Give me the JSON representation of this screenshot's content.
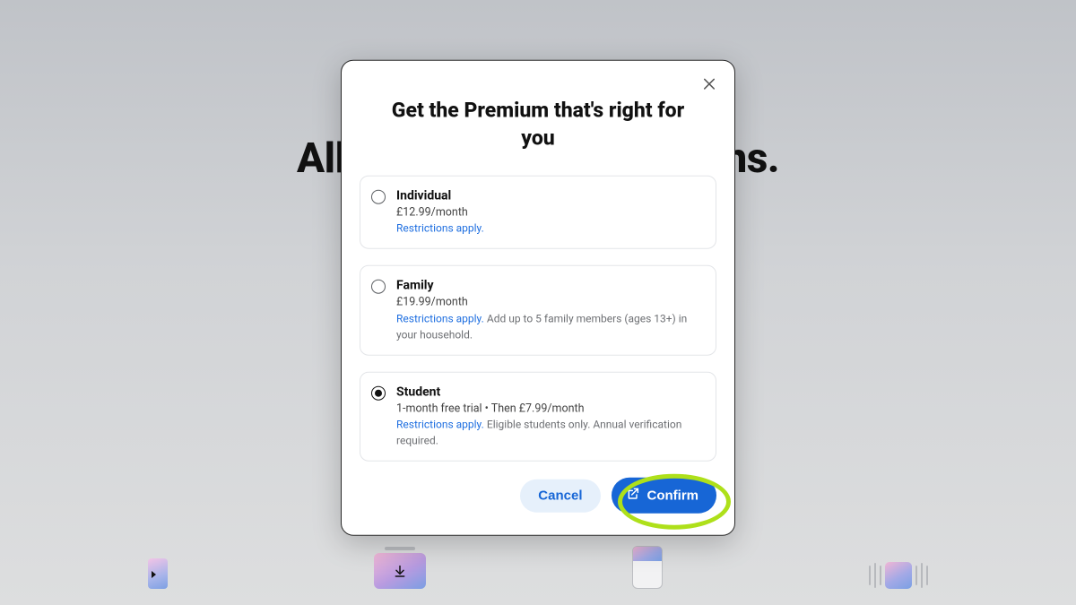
{
  "hero": {
    "text": "All Your Premium Options."
  },
  "modal": {
    "title": "Get the Premium that's right for you",
    "plans": [
      {
        "name": "Individual",
        "price": "£12.99/month",
        "restrictions_label": "Restrictions apply.",
        "extra": "",
        "selected": false
      },
      {
        "name": "Family",
        "price": "£19.99/month",
        "restrictions_label": "Restrictions apply.",
        "extra": "Add up to 5 family members (ages 13+) in your household.",
        "selected": false
      },
      {
        "name": "Student",
        "price": "1-month free trial • Then £7.99/month",
        "restrictions_label": "Restrictions apply.",
        "extra": "Eligible students only. Annual verification required.",
        "selected": true
      }
    ],
    "cancel_label": "Cancel",
    "confirm_label": "Confirm"
  }
}
